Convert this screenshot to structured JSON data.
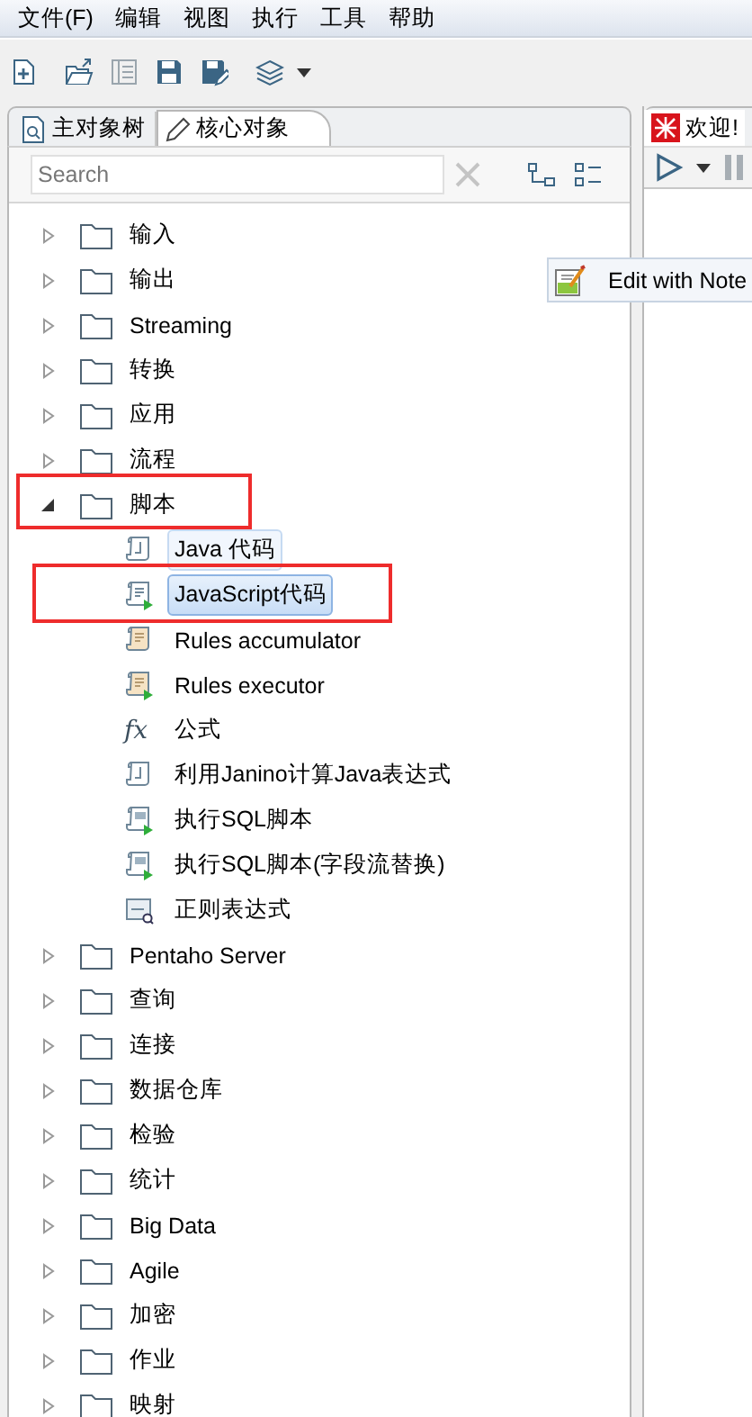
{
  "menu": [
    {
      "label": "文件(F)"
    },
    {
      "label": "编辑"
    },
    {
      "label": "视图"
    },
    {
      "label": "执行"
    },
    {
      "label": "工具"
    },
    {
      "label": "帮助"
    }
  ],
  "toolbar": [
    {
      "kind": "new",
      "disabled": false
    },
    {
      "kind": "open",
      "disabled": false
    },
    {
      "kind": "list",
      "disabled": true
    },
    {
      "kind": "save",
      "disabled": false
    },
    {
      "kind": "save-as",
      "disabled": false
    },
    {
      "kind": "layers",
      "disabled": false
    }
  ],
  "left_tabs": [
    {
      "label": "主对象树",
      "kind": "tree",
      "selected": false
    },
    {
      "label": "核心对象",
      "kind": "pencil",
      "selected": true
    }
  ],
  "search": {
    "placeholder": "Search"
  },
  "tree": [
    {
      "label": "输入",
      "kind": "folder",
      "expanded": false,
      "selected": false
    },
    {
      "label": "输出",
      "kind": "folder",
      "expanded": false,
      "selected": false
    },
    {
      "label": "Streaming",
      "kind": "folder",
      "expanded": false,
      "selected": false
    },
    {
      "label": "转换",
      "kind": "folder",
      "expanded": false,
      "selected": false
    },
    {
      "label": "应用",
      "kind": "folder",
      "expanded": false,
      "selected": false
    },
    {
      "label": "流程",
      "kind": "folder",
      "expanded": false,
      "selected": false
    },
    {
      "label": "脚本",
      "kind": "folder",
      "expanded": true,
      "selected": false,
      "children": [
        {
          "label": "Java 代码",
          "kind": "script",
          "selected": false,
          "hovered": true
        },
        {
          "label": "JavaScript代码",
          "kind": "script-run",
          "selected": true,
          "hovered": false
        },
        {
          "label": "Rules accumulator",
          "kind": "script-doc",
          "selected": false,
          "hovered": false
        },
        {
          "label": "Rules executor",
          "kind": "script-doc-run",
          "selected": false,
          "hovered": false
        },
        {
          "label": "公式",
          "kind": "formula",
          "symbol": "fx",
          "selected": false,
          "hovered": false
        },
        {
          "label": "利用Janino计算Java表达式",
          "kind": "script",
          "selected": false,
          "hovered": false
        },
        {
          "label": "执行SQL脚本",
          "kind": "sql",
          "selected": false,
          "hovered": false
        },
        {
          "label": "执行SQL脚本(字段流替换)",
          "kind": "sql",
          "selected": false,
          "hovered": false
        },
        {
          "label": "正则表达式",
          "kind": "regex",
          "selected": false,
          "hovered": false
        }
      ]
    },
    {
      "label": "Pentaho Server",
      "kind": "folder",
      "expanded": false,
      "selected": false
    },
    {
      "label": "查询",
      "kind": "folder",
      "expanded": false,
      "selected": false
    },
    {
      "label": "连接",
      "kind": "folder",
      "expanded": false,
      "selected": false
    },
    {
      "label": "数据仓库",
      "kind": "folder",
      "expanded": false,
      "selected": false
    },
    {
      "label": "检验",
      "kind": "folder",
      "expanded": false,
      "selected": false
    },
    {
      "label": "统计",
      "kind": "folder",
      "expanded": false,
      "selected": false
    },
    {
      "label": "Big Data",
      "kind": "folder",
      "expanded": false,
      "selected": false
    },
    {
      "label": "Agile",
      "kind": "folder",
      "expanded": false,
      "selected": false
    },
    {
      "label": "加密",
      "kind": "folder",
      "expanded": false,
      "selected": false
    },
    {
      "label": "作业",
      "kind": "folder",
      "expanded": false,
      "selected": false
    },
    {
      "label": "映射",
      "kind": "folder",
      "expanded": false,
      "selected": false
    }
  ],
  "right_tab": {
    "label": "欢迎!",
    "selected": true
  },
  "popup": {
    "label": "Edit with Note"
  }
}
